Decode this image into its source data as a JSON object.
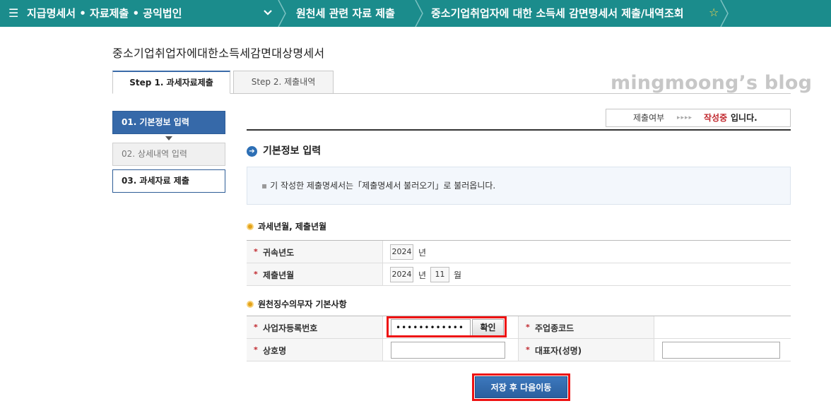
{
  "topbar": {
    "crumb1": "지급명세서 • 자료제출 • 공익법인",
    "crumb2": "원천세 관련 자료 제출",
    "crumb3": "중소기업취업자에 대한 소득세 감면명세서 제출/내역조회",
    "menu_icon": "hamburger-icon",
    "chevron_icon": "chevron-down-icon",
    "favorite_icon": "star-outline-icon",
    "accent_color": "#1b8c8c"
  },
  "page_title": "중소기업취업자에대한소득세감면대상명세서",
  "tabs": [
    {
      "label": "Step 1. 과세자료제출",
      "active": true
    },
    {
      "label": "Step 2. 제출내역",
      "active": false
    }
  ],
  "watermark": "mingmoong’s blog",
  "steps": [
    {
      "label": "01. 기본정보 입력",
      "state": "current"
    },
    {
      "label": "02. 상세내역 입력",
      "state": "disabled"
    },
    {
      "label": "03. 과세자료 제출",
      "state": "normal"
    }
  ],
  "status": {
    "label": "제출여부",
    "arrows": "▸▸▸▸",
    "value": "작성중",
    "suffix": "입니다."
  },
  "section_title": "기본정보 입력",
  "info_text": "기 작성한 제출명세서는「제출명세서 불러오기」로 불러옵니다.",
  "period_section": {
    "title": "과세년월, 제출년월",
    "rows": [
      {
        "label": "귀속년도",
        "year": "2024",
        "year_unit": "년"
      },
      {
        "label": "제출년월",
        "year": "2024",
        "year_unit": "년",
        "month": "11",
        "month_unit": "월"
      }
    ]
  },
  "withholder_section": {
    "title": "원천징수의무자 기본사항",
    "biz_no_label": "사업자등록번호",
    "biz_no_value": "••••••••••••",
    "confirm_label": "확인",
    "industry_code_label": "주업종코드",
    "company_name_label": "상호명",
    "company_name_value": "",
    "rep_name_label": "대표자(성명)",
    "rep_name_value": ""
  },
  "required_mark": "*",
  "save_button_label": "저장 후 다음이동",
  "highlight_color": "#ee1111"
}
